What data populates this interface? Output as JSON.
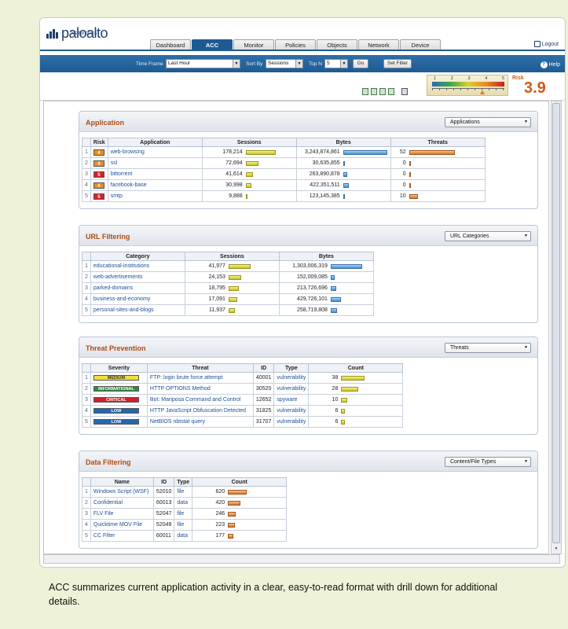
{
  "header": {
    "logo_text": "paloalto",
    "logo_sub": "NETWORKS",
    "tabs": [
      "Dashboard",
      "ACC",
      "Monitor",
      "Policies",
      "Objects",
      "Network",
      "Device"
    ],
    "active_tab": "ACC",
    "logout": "Logout"
  },
  "toolbar": {
    "time_frame_label": "Time Frame",
    "time_frame_value": "Last Hour",
    "sort_by_label": "Sort By",
    "sort_by_value": "Sessions",
    "top_n_label": "Top N",
    "top_n_value": "5",
    "go_label": "Go",
    "set_filter_label": "Set Filter",
    "help_label": "Help"
  },
  "risk_meter": {
    "scale": [
      "1",
      "2",
      "3",
      "4",
      "5"
    ],
    "label": "Risk",
    "value": "3.9",
    "level": 3.9
  },
  "application": {
    "title": "Application",
    "dropdown": "Applications",
    "headers": [
      "Risk",
      "Application",
      "Sessions",
      "Bytes",
      "Threats"
    ],
    "rows": [
      {
        "n": "1",
        "risk": "4",
        "name": "web-browsing",
        "sessions": "178,214",
        "s": 178214,
        "bytes": "3,243,874,861",
        "b": 3243874861,
        "threats": "52",
        "t": 52
      },
      {
        "n": "2",
        "risk": "4",
        "name": "ssl",
        "sessions": "72,694",
        "s": 72694,
        "bytes": "30,635,855",
        "b": 30635855,
        "threats": "0",
        "t": 0
      },
      {
        "n": "3",
        "risk": "5",
        "name": "bittorrent",
        "sessions": "41,614",
        "s": 41614,
        "bytes": "263,890,878",
        "b": 263890878,
        "threats": "0",
        "t": 0
      },
      {
        "n": "4",
        "risk": "4",
        "name": "facebook-base",
        "sessions": "30,998",
        "s": 30998,
        "bytes": "422,351,511",
        "b": 422351511,
        "threats": "0",
        "t": 0
      },
      {
        "n": "5",
        "risk": "5",
        "name": "smtp",
        "sessions": "9,888",
        "s": 9888,
        "bytes": "123,145,385",
        "b": 123145385,
        "threats": "10",
        "t": 10
      }
    ]
  },
  "url_filtering": {
    "title": "URL Filtering",
    "dropdown": "URL Categories",
    "headers": [
      "Category",
      "Sessions",
      "Bytes"
    ],
    "rows": [
      {
        "n": "1",
        "name": "educational-institutions",
        "sessions": "41,977",
        "s": 41977,
        "bytes": "1,303,006,319",
        "b": 1303006319
      },
      {
        "n": "2",
        "name": "web-advertisements",
        "sessions": "24,153",
        "s": 24153,
        "bytes": "152,009,085",
        "b": 152009085
      },
      {
        "n": "3",
        "name": "parked-domains",
        "sessions": "18,795",
        "s": 18795,
        "bytes": "213,726,696",
        "b": 213726696
      },
      {
        "n": "4",
        "name": "business-and-economy",
        "sessions": "17,091",
        "s": 17091,
        "bytes": "429,726,101",
        "b": 429726101
      },
      {
        "n": "5",
        "name": "personal-sites-and-blogs",
        "sessions": "11,937",
        "s": 11937,
        "bytes": "258,719,808",
        "b": 258719808
      }
    ]
  },
  "threat_prevention": {
    "title": "Threat Prevention",
    "dropdown": "Threats",
    "headers": [
      "Severity",
      "Threat",
      "ID",
      "Type",
      "Count"
    ],
    "rows": [
      {
        "n": "1",
        "severity": "MEDIUM",
        "sev_color": "#f0df3c",
        "sev_text": "#333333",
        "threat": "FTP: login brute force attempt",
        "id": "40001",
        "type": "vulnerability",
        "count": "38",
        "c": 38
      },
      {
        "n": "2",
        "severity": "INFORMATIONAL",
        "sev_color": "#2e8a3e",
        "sev_text": "#ffffff",
        "threat": "HTTP OPTIONS Method",
        "id": "30520",
        "type": "vulnerability",
        "count": "28",
        "c": 28
      },
      {
        "n": "3",
        "severity": "CRITICAL",
        "sev_color": "#d3202a",
        "sev_text": "#ffffff",
        "threat": "Bot: Mariposa Command and Control",
        "id": "12652",
        "type": "spyware",
        "count": "10",
        "c": 10
      },
      {
        "n": "4",
        "severity": "LOW",
        "sev_color": "#2466b0",
        "sev_text": "#ffffff",
        "threat": "HTTP JavaScript Obfuscation Detected",
        "id": "31825",
        "type": "vulnerability",
        "count": "6",
        "c": 6
      },
      {
        "n": "5",
        "severity": "LOW",
        "sev_color": "#2466b0",
        "sev_text": "#ffffff",
        "threat": "NetBIOS nbtstat query",
        "id": "31707",
        "type": "vulnerability",
        "count": "6",
        "c": 6
      }
    ]
  },
  "data_filtering": {
    "title": "Data Filtering",
    "dropdown": "Content/File Types",
    "headers": [
      "Name",
      "ID",
      "Type",
      "Count"
    ],
    "rows": [
      {
        "n": "1",
        "name": "Windows Script (WSF)",
        "id": "52010",
        "type": "file",
        "count": "620",
        "c": 620
      },
      {
        "n": "2",
        "name": "Confidential",
        "id": "60013",
        "type": "data",
        "count": "420",
        "c": 420
      },
      {
        "n": "3",
        "name": "FLV File",
        "id": "52047",
        "type": "file",
        "count": "246",
        "c": 246
      },
      {
        "n": "4",
        "name": "Quicktime MOV File",
        "id": "52049",
        "type": "file",
        "count": "223",
        "c": 223
      },
      {
        "n": "5",
        "name": "CC Filter",
        "id": "60011",
        "type": "data",
        "count": "177",
        "c": 177
      }
    ]
  },
  "colors": {
    "brand_blue": "#1e5b94",
    "section_title": "#b14a14",
    "risk_high": "#d3202a",
    "risk_med": "#e58f22"
  },
  "caption": "ACC summarizes current application activity in a clear, easy-to-read format with drill down for additional details."
}
